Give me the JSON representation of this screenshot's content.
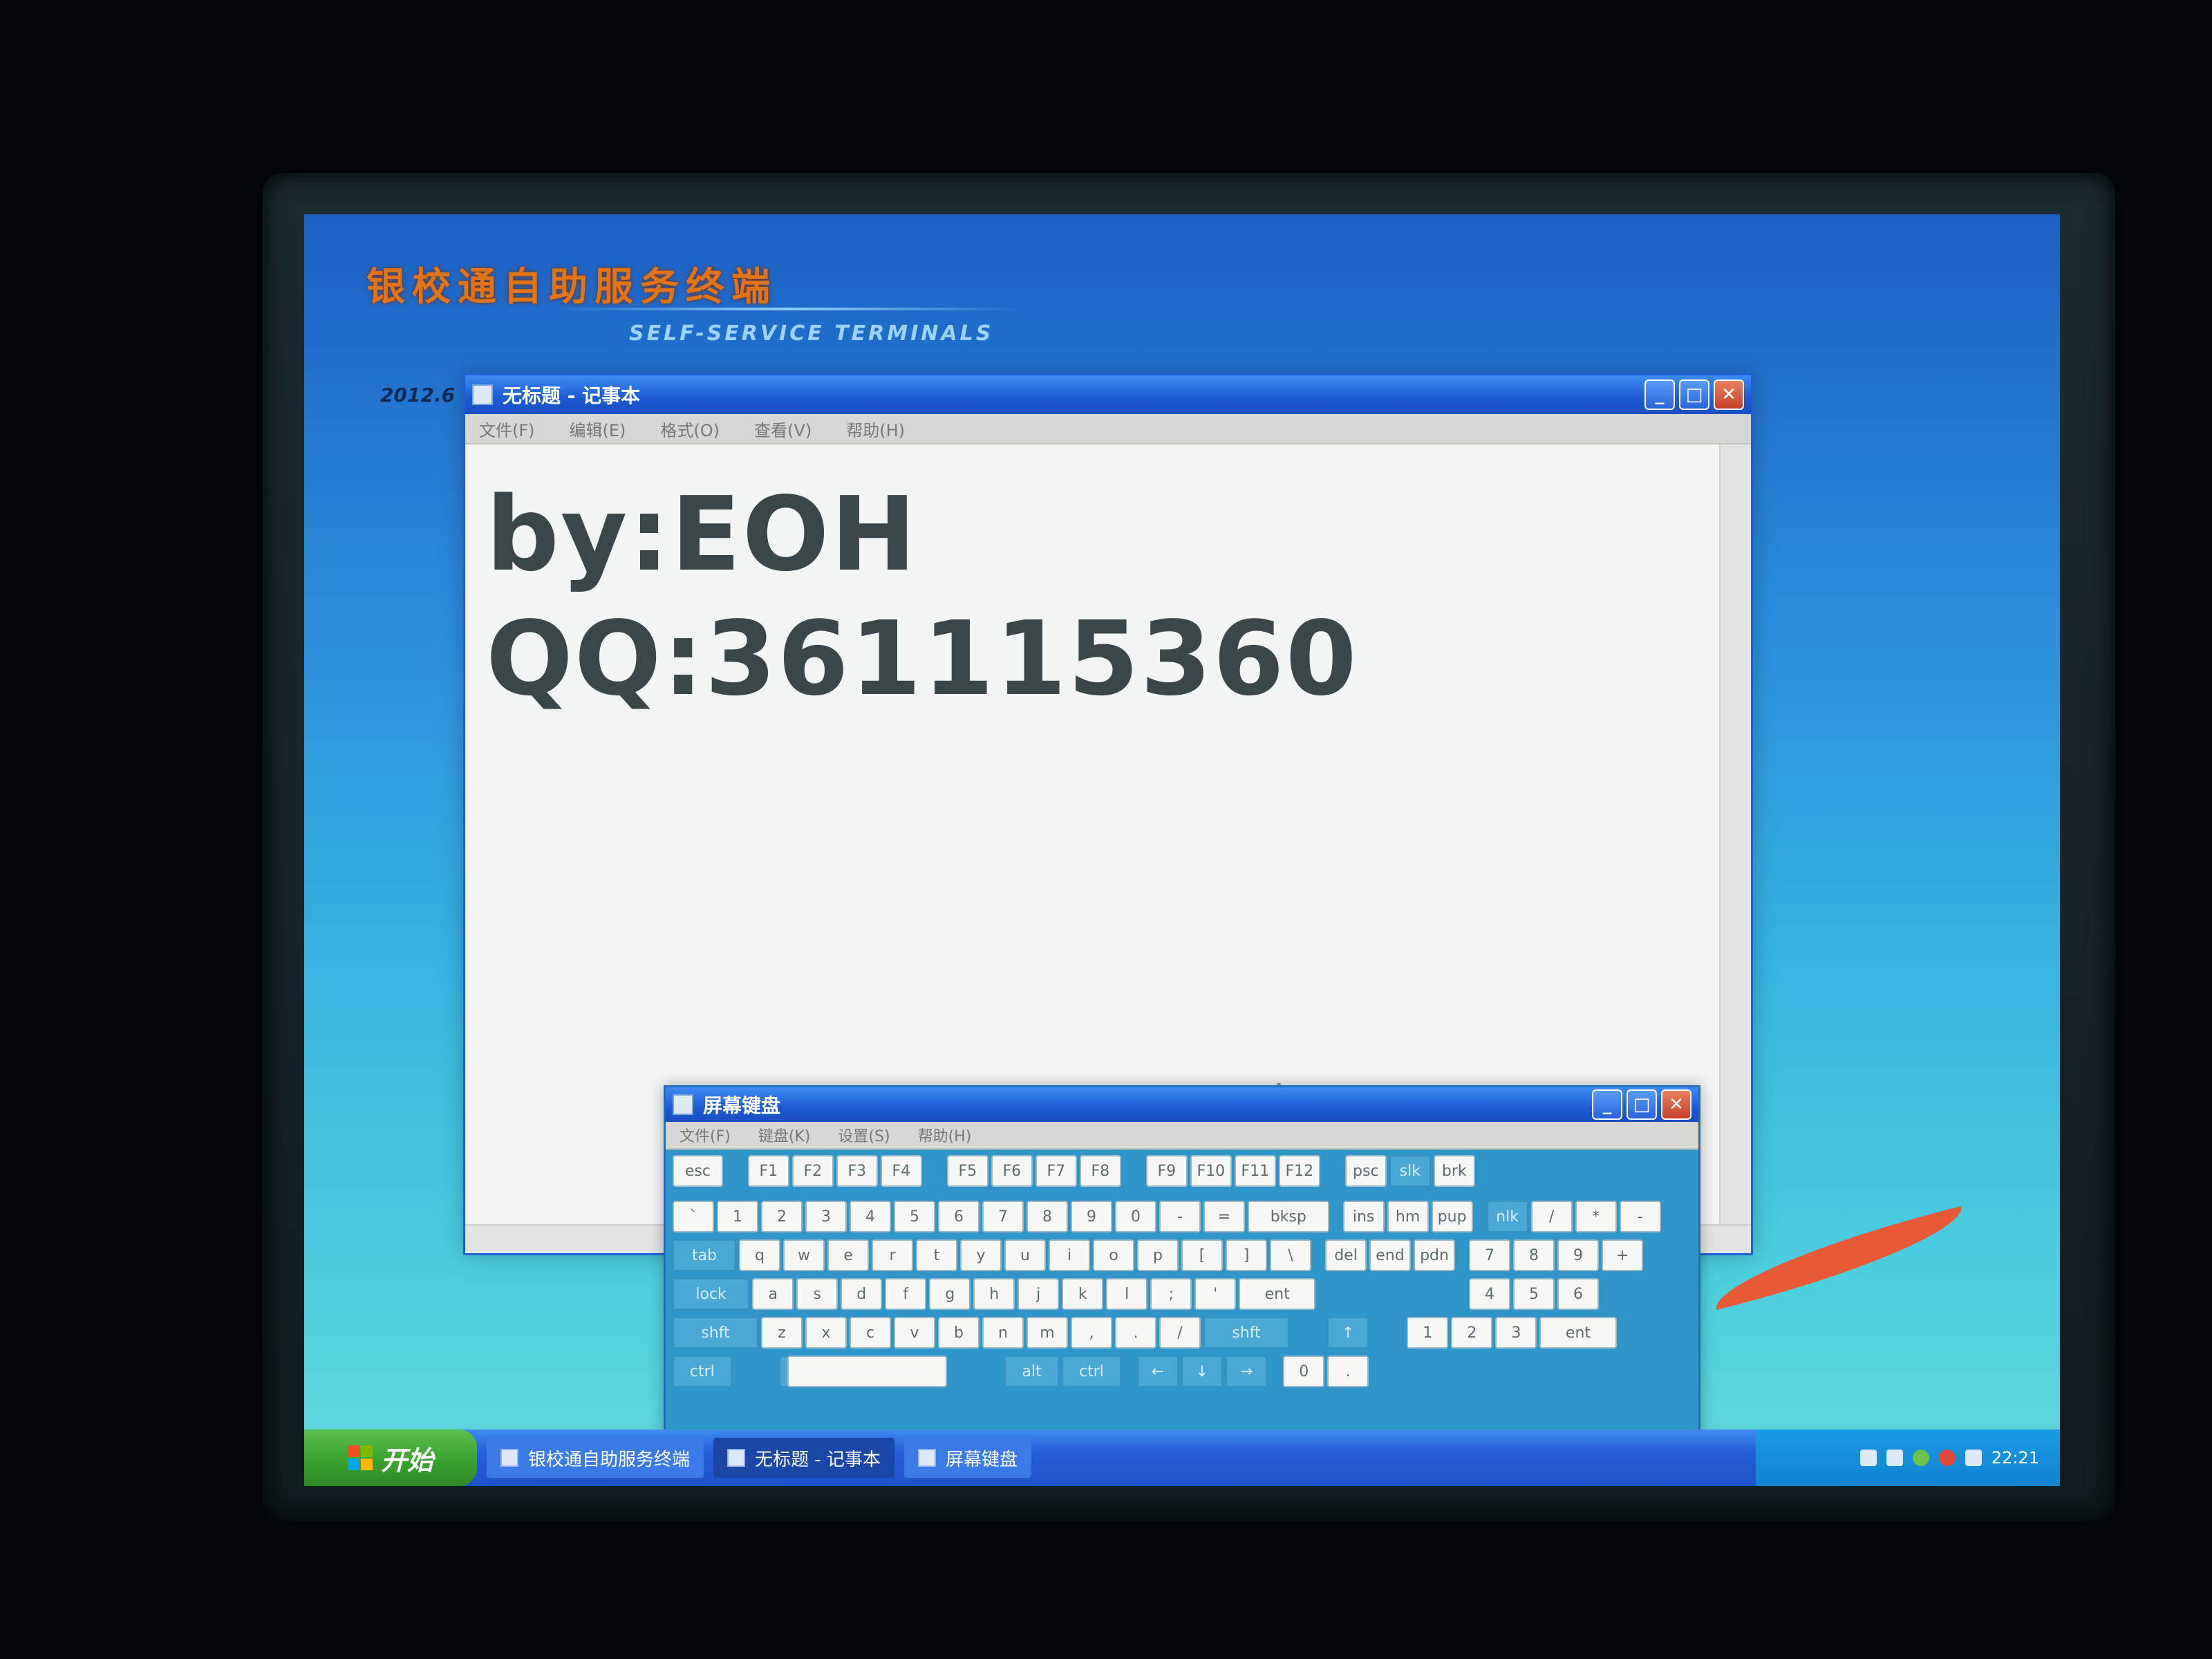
{
  "desktop": {
    "brand_title": "银校通自助服务终端",
    "brand_subtitle": "SELF-SERVICE TERMINALS",
    "brand_tag": "2012.6"
  },
  "notepad": {
    "title": "无标题 - 记事本",
    "menu": [
      "文件(F)",
      "编辑(E)",
      "格式(O)",
      "查看(V)",
      "帮助(H)"
    ],
    "lines": [
      "by:EOH",
      "QQ:361115360"
    ]
  },
  "osk": {
    "title": "屏幕键盘",
    "menu": [
      "文件(F)",
      "键盘(K)",
      "设置(S)",
      "帮助(H)"
    ],
    "rows": [
      [
        "esc",
        "F1",
        "F2",
        "F3",
        "F4",
        "F5",
        "F6",
        "F7",
        "F8",
        "F9",
        "F10",
        "F11",
        "F12",
        "psc",
        "slk",
        "brk"
      ],
      [
        "`",
        "1",
        "2",
        "3",
        "4",
        "5",
        "6",
        "7",
        "8",
        "9",
        "0",
        "-",
        "=",
        "bksp",
        "ins",
        "hm",
        "pup",
        "nlk",
        "/",
        "*",
        "-"
      ],
      [
        "tab",
        "q",
        "w",
        "e",
        "r",
        "t",
        "y",
        "u",
        "i",
        "o",
        "p",
        "[",
        "]",
        "\\",
        "del",
        "end",
        "pdn",
        "7",
        "8",
        "9",
        "+"
      ],
      [
        "lock",
        "a",
        "s",
        "d",
        "f",
        "g",
        "h",
        "j",
        "k",
        "l",
        ";",
        "'",
        "ent",
        "4",
        "5",
        "6"
      ],
      [
        "shft",
        "z",
        "x",
        "c",
        "v",
        "b",
        "n",
        "m",
        ",",
        ".",
        "/",
        "shft",
        "↑",
        "1",
        "2",
        "3",
        "ent"
      ],
      [
        "ctrl",
        "alt",
        "alt",
        "ctrl",
        "←",
        "↓",
        "→",
        "0",
        "."
      ]
    ]
  },
  "taskbar": {
    "start_label": "开始",
    "tasks": [
      "银校通自助服务终端",
      "无标题 - 记事本",
      "屏幕键盘"
    ],
    "clock": "22:21"
  },
  "colors": {
    "titlebar": "#1c5ad4",
    "start": "#37a02c",
    "brand": "#e0741a"
  }
}
